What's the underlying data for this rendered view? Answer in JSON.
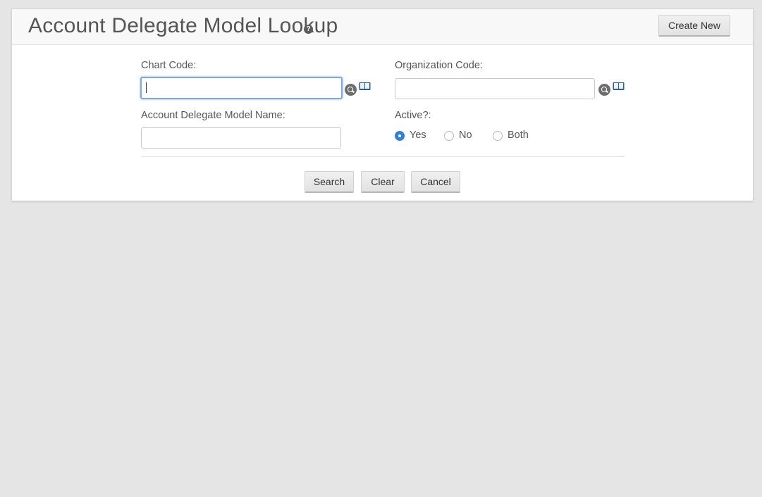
{
  "header": {
    "title": "Account Delegate Model Lookup",
    "help_icon": "question-circle-icon",
    "create_new_label": "Create New"
  },
  "form": {
    "chart_code": {
      "label": "Chart Code:",
      "value": "",
      "focused": true,
      "icons": [
        "search-icon",
        "book-icon"
      ]
    },
    "organization_code": {
      "label": "Organization Code:",
      "value": "",
      "icons": [
        "search-icon",
        "book-icon"
      ]
    },
    "model_name": {
      "label": "Account Delegate Model Name:",
      "value": ""
    },
    "active": {
      "label": "Active?:",
      "options": [
        "Yes",
        "No",
        "Both"
      ],
      "selected": "Yes"
    }
  },
  "actions": {
    "search_label": "Search",
    "clear_label": "Clear",
    "cancel_label": "Cancel"
  },
  "colors": {
    "background": "#e5e5e5",
    "panel": "#ffffff",
    "header_bg": "#f8f8f8",
    "focus_border": "#7ba9e6",
    "radio_selected": "#2f7fe0"
  }
}
